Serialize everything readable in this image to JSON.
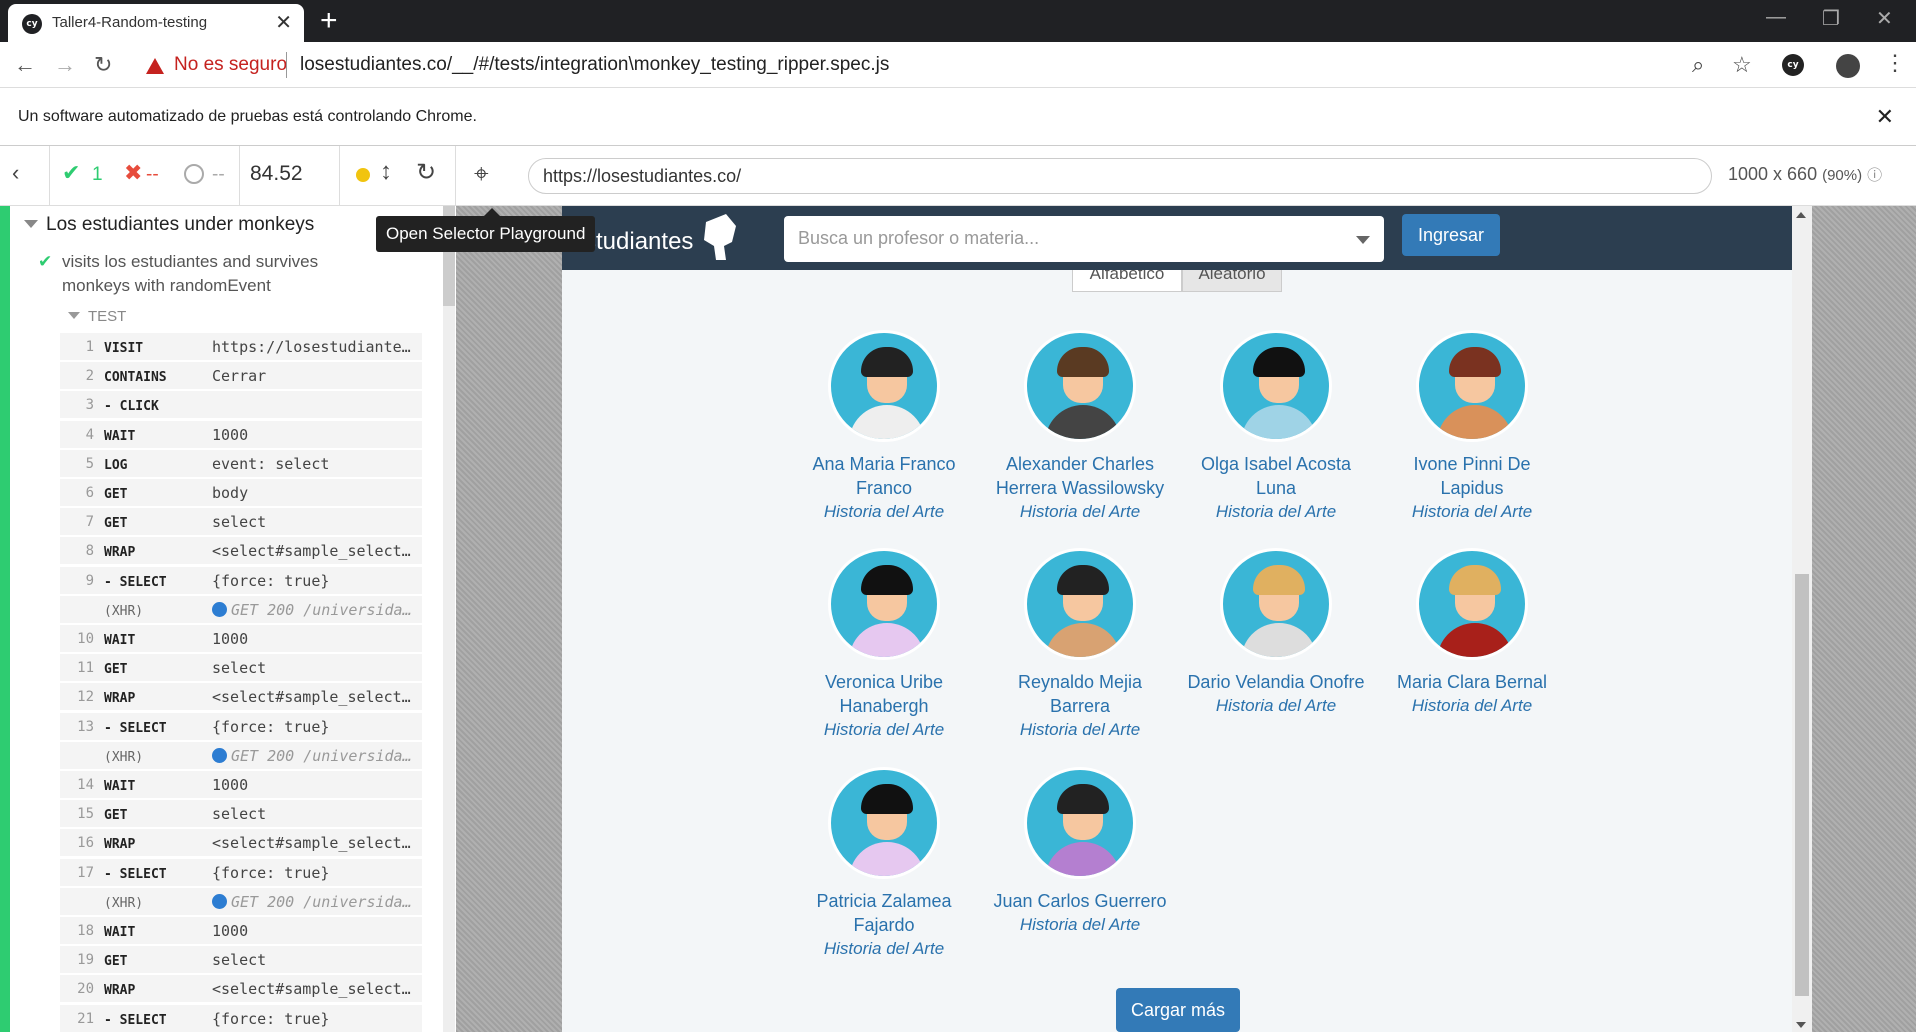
{
  "browser": {
    "tab_title": "Taller4-Random-testing",
    "tab_icon": "cy",
    "security_label": "No es seguro",
    "url": "losestudiantes.co/__/#/tests/integration\\monkey_testing_ripper.spec.js",
    "info_message": "Un software automatizado de pruebas está controlando Chrome.",
    "profile_icon": "cy"
  },
  "runner": {
    "passed": "1",
    "failed": "--",
    "pending": "--",
    "duration": "84.52",
    "tooltip": "Open Selector Playground",
    "app_url": "https://losestudiantes.co/",
    "viewport": "1000 x 660",
    "scale": "(90%)",
    "suite": "Los estudiantes under monkeys",
    "test_title_1": "visits los estudiantes and survives",
    "test_title_2": "monkeys with randomEvent",
    "section": "TEST",
    "commands": [
      {
        "n": "1",
        "cmd": "VISIT",
        "msg": "https://losestudiante…"
      },
      {
        "n": "2",
        "cmd": "CONTAINS",
        "msg": "Cerrar"
      },
      {
        "n": "3",
        "cmd": "- CLICK",
        "msg": ""
      },
      {
        "n": "4",
        "cmd": "WAIT",
        "msg": "1000"
      },
      {
        "n": "5",
        "cmd": "LOG",
        "msg": "event: select"
      },
      {
        "n": "6",
        "cmd": "GET",
        "msg": "body"
      },
      {
        "n": "7",
        "cmd": "GET",
        "msg": "select"
      },
      {
        "n": "8",
        "cmd": "WRAP",
        "msg": "<select#sample_select…"
      },
      {
        "n": "9",
        "cmd": "- SELECT",
        "msg": "{force: true}"
      },
      {
        "n": "",
        "cmd": "(XHR)",
        "msg": "GET 200 /universida…",
        "xhr": true
      },
      {
        "n": "10",
        "cmd": "WAIT",
        "msg": "1000"
      },
      {
        "n": "11",
        "cmd": "GET",
        "msg": "select"
      },
      {
        "n": "12",
        "cmd": "WRAP",
        "msg": "<select#sample_select…"
      },
      {
        "n": "13",
        "cmd": "- SELECT",
        "msg": "{force: true}"
      },
      {
        "n": "",
        "cmd": "(XHR)",
        "msg": "GET 200 /universida…",
        "xhr": true
      },
      {
        "n": "14",
        "cmd": "WAIT",
        "msg": "1000"
      },
      {
        "n": "15",
        "cmd": "GET",
        "msg": "select"
      },
      {
        "n": "16",
        "cmd": "WRAP",
        "msg": "<select#sample_select…"
      },
      {
        "n": "17",
        "cmd": "- SELECT",
        "msg": "{force: true}"
      },
      {
        "n": "",
        "cmd": "(XHR)",
        "msg": "GET 200 /universida…",
        "xhr": true
      },
      {
        "n": "18",
        "cmd": "WAIT",
        "msg": "1000"
      },
      {
        "n": "19",
        "cmd": "GET",
        "msg": "select"
      },
      {
        "n": "20",
        "cmd": "WRAP",
        "msg": "<select#sample_select…"
      },
      {
        "n": "21",
        "cmd": "- SELECT",
        "msg": "{force: true}"
      }
    ]
  },
  "app": {
    "brand": "Estudiantes",
    "search_placeholder": "Busca un profesor o materia...",
    "login_label": "Ingresar",
    "sort_alpha": "Alfabético",
    "sort_random": "Aleatorio",
    "load_more": "Cargar más",
    "professors": [
      {
        "name": "Ana Maria Franco Franco",
        "subject": "Historia del Arte",
        "hair": "#222",
        "shirt": "#eeeeee"
      },
      {
        "name": "Alexander Charles Herrera Wassilowsky",
        "subject": "Historia del Arte",
        "hair": "#5a3a22",
        "shirt": "#444444"
      },
      {
        "name": "Olga Isabel Acosta Luna",
        "subject": "Historia del Arte",
        "hair": "#111",
        "shirt": "#9fd3e6"
      },
      {
        "name": "Ivone Pinni De Lapidus",
        "subject": "Historia del Arte",
        "hair": "#7a3220",
        "shirt": "#d9915a"
      },
      {
        "name": "Veronica Uribe Hanabergh",
        "subject": "Historia del Arte",
        "hair": "#111",
        "shirt": "#e6c8f0"
      },
      {
        "name": "Reynaldo Mejia Barrera",
        "subject": "Historia del Arte",
        "hair": "#222",
        "shirt": "#d8a272"
      },
      {
        "name": "Dario Velandia Onofre",
        "subject": "Historia del Arte",
        "hair": "#e0b060",
        "shirt": "#dddddd"
      },
      {
        "name": "Maria Clara Bernal",
        "subject": "Historia del Arte",
        "hair": "#e0b060",
        "shirt": "#a8201a"
      },
      {
        "name": "Patricia Zalamea Fajardo",
        "subject": "Historia del Arte",
        "hair": "#111",
        "shirt": "#e6c8f0"
      },
      {
        "name": "Juan Carlos Guerrero",
        "subject": "Historia del Arte",
        "hair": "#222",
        "shirt": "#b47fd0"
      }
    ]
  }
}
